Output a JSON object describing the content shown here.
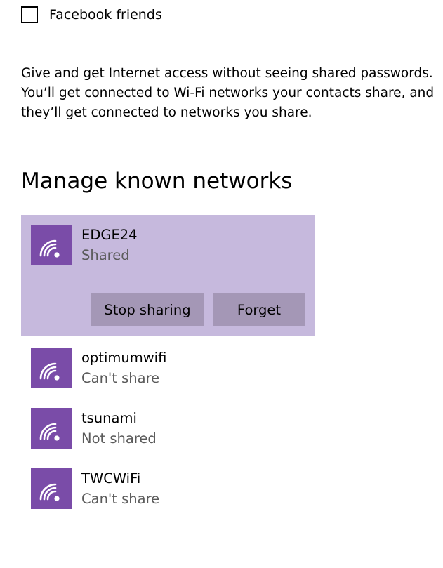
{
  "checkbox": {
    "label": "Facebook friends",
    "checked": false
  },
  "description": {
    "line1": "Give and get Internet access without seeing shared passwords.",
    "line2": "You’ll get connected to Wi-Fi networks your contacts share, and",
    "line3": "they’ll get connected to networks you share."
  },
  "section_title": "Manage known networks",
  "networks": [
    {
      "name": "EDGE24",
      "status": "Shared",
      "selected": true,
      "icon": "wifi-icon",
      "actions": {
        "stop_sharing": "Stop sharing",
        "forget": "Forget"
      }
    },
    {
      "name": "optimumwifi",
      "status": "Can't share",
      "selected": false,
      "icon": "wifi-icon"
    },
    {
      "name": "tsunami",
      "status": "Not shared",
      "selected": false,
      "icon": "wifi-icon"
    },
    {
      "name": "TWCWiFi",
      "status": "Can't share",
      "selected": false,
      "icon": "wifi-icon"
    }
  ],
  "colors": {
    "accent": "#7a4ca8",
    "selected_background": "#c6b9dd",
    "button_background": "#a497b6",
    "secondary_text": "#5a5a5a"
  }
}
